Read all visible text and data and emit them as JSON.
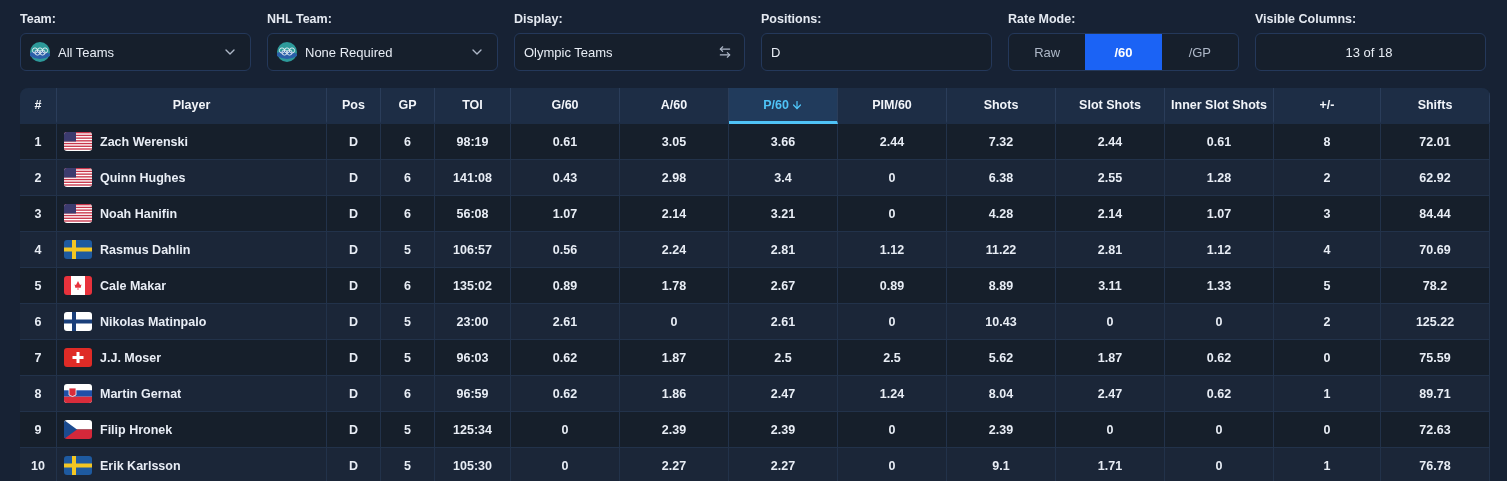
{
  "filters": [
    {
      "kind": "dropdown",
      "label": "Team:",
      "value": "All Teams",
      "logo": true
    },
    {
      "kind": "dropdown",
      "label": "NHL Team:",
      "value": "None Required",
      "logo": true
    },
    {
      "kind": "swap",
      "label": "Display:",
      "value": "Olympic Teams"
    },
    {
      "kind": "text",
      "label": "Positions:",
      "value": "D"
    },
    {
      "kind": "segments",
      "label": "Rate Mode:",
      "options": [
        {
          "label": "Raw",
          "selected": false
        },
        {
          "label": "/60",
          "selected": true
        },
        {
          "label": "/GP",
          "selected": false
        }
      ]
    },
    {
      "kind": "button",
      "label": "Visible Columns:",
      "value": "13 of 18"
    }
  ],
  "table": {
    "columns": [
      {
        "label": "#",
        "sorted": false
      },
      {
        "label": "Player",
        "sorted": false
      },
      {
        "label": "Pos",
        "sorted": false
      },
      {
        "label": "GP",
        "sorted": false
      },
      {
        "label": "TOI",
        "sorted": false
      },
      {
        "label": "G/60",
        "sorted": false
      },
      {
        "label": "A/60",
        "sorted": false
      },
      {
        "label": "P/60",
        "sorted": true
      },
      {
        "label": "PIM/60",
        "sorted": false
      },
      {
        "label": "Shots",
        "sorted": false
      },
      {
        "label": "Slot Shots",
        "sorted": false
      },
      {
        "label": "Inner Slot Shots",
        "sorted": false
      },
      {
        "label": "+/-",
        "sorted": false
      },
      {
        "label": "Shifts",
        "sorted": false
      }
    ],
    "rows": [
      {
        "flag": {
          "kind": "usa"
        },
        "cells": [
          "1",
          "Zach Werenski",
          "D",
          "6",
          "98:19",
          "0.61",
          "3.05",
          "3.66",
          "2.44",
          "7.32",
          "2.44",
          "0.61",
          "8",
          "72.01"
        ]
      },
      {
        "flag": {
          "kind": "usa"
        },
        "cells": [
          "2",
          "Quinn Hughes",
          "D",
          "6",
          "141:08",
          "0.43",
          "2.98",
          "3.4",
          "0",
          "6.38",
          "2.55",
          "1.28",
          "2",
          "62.92"
        ]
      },
      {
        "flag": {
          "kind": "usa"
        },
        "cells": [
          "3",
          "Noah Hanifin",
          "D",
          "6",
          "56:08",
          "1.07",
          "2.14",
          "3.21",
          "0",
          "4.28",
          "2.14",
          "1.07",
          "3",
          "84.44"
        ]
      },
      {
        "flag": {
          "kind": "swe"
        },
        "cells": [
          "4",
          "Rasmus Dahlin",
          "D",
          "5",
          "106:57",
          "0.56",
          "2.24",
          "2.81",
          "1.12",
          "11.22",
          "2.81",
          "1.12",
          "4",
          "70.69"
        ]
      },
      {
        "flag": {
          "kind": "can"
        },
        "cells": [
          "5",
          "Cale Makar",
          "D",
          "6",
          "135:02",
          "0.89",
          "1.78",
          "2.67",
          "0.89",
          "8.89",
          "3.11",
          "1.33",
          "5",
          "78.2"
        ]
      },
      {
        "flag": {
          "kind": "fin"
        },
        "cells": [
          "6",
          "Nikolas Matinpalo",
          "D",
          "5",
          "23:00",
          "2.61",
          "0",
          "2.61",
          "0",
          "10.43",
          "0",
          "0",
          "2",
          "125.22"
        ]
      },
      {
        "flag": {
          "kind": "sui"
        },
        "cells": [
          "7",
          "J.J. Moser",
          "D",
          "5",
          "96:03",
          "0.62",
          "1.87",
          "2.5",
          "2.5",
          "5.62",
          "1.87",
          "0.62",
          "0",
          "75.59"
        ]
      },
      {
        "flag": {
          "kind": "svk"
        },
        "cells": [
          "8",
          "Martin Gernat",
          "D",
          "6",
          "96:59",
          "0.62",
          "1.86",
          "2.47",
          "1.24",
          "8.04",
          "2.47",
          "0.62",
          "1",
          "89.71"
        ]
      },
      {
        "flag": {
          "kind": "cze"
        },
        "cells": [
          "9",
          "Filip Hronek",
          "D",
          "5",
          "125:34",
          "0",
          "2.39",
          "2.39",
          "0",
          "2.39",
          "0",
          "0",
          "0",
          "72.63"
        ]
      },
      {
        "flag": {
          "kind": "swe"
        },
        "cells": [
          "10",
          "Erik Karlsson",
          "D",
          "5",
          "105:30",
          "0",
          "2.27",
          "2.27",
          "0",
          "9.1",
          "1.71",
          "0",
          "1",
          "76.78"
        ]
      }
    ]
  }
}
